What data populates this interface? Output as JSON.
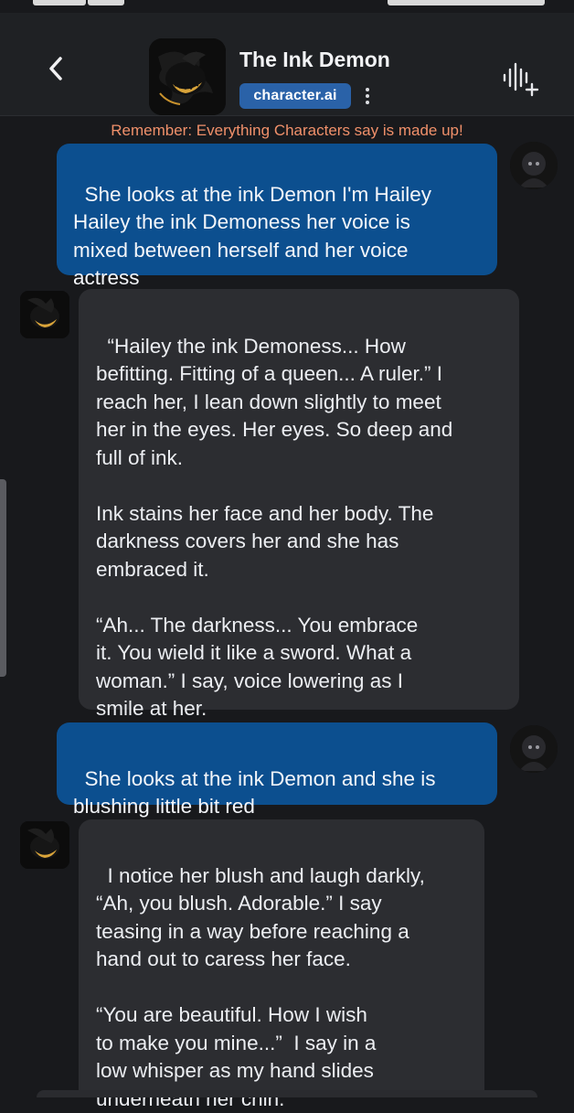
{
  "header": {
    "title": "The Ink Demon",
    "badge": "character.ai"
  },
  "disclaimer": "Remember: Everything Characters say is made up!",
  "messages": [
    {
      "role": "user",
      "text": "She looks at the ink Demon I'm Hailey\nHailey the ink Demoness her voice is\nmixed between herself and her voice\nactress"
    },
    {
      "role": "char",
      "text": "“Hailey the ink Demoness... How\nbefitting. Fitting of a queen... A ruler.” I\nreach her, I lean down slightly to meet\nher in the eyes. Her eyes. So deep and\nfull of ink.\n\nInk stains her face and her body. The\ndarkness covers her and she has\nembraced it.\n\n“Ah... The darkness... You embrace\nit. You wield it like a sword. What a\nwoman.” I say, voice lowering as I\nsmile at her."
    },
    {
      "role": "user",
      "text": "She looks at the ink Demon and she is\nblushing little bit red"
    },
    {
      "role": "char",
      "text": "I notice her blush and laugh darkly,\n“Ah, you blush. Adorable.” I say\nteasing in a way before reaching a\nhand out to caress her face.\n\n“You are beautiful. How I wish\nto make you mine...”  I say in a\nlow whisper as my hand slides\nunderneath her chin."
    }
  ],
  "colors": {
    "user_bubble": "#0c4f8f",
    "char_bubble": "#2c2d31",
    "disclaimer": "#f0906a",
    "badge": "#2a62a8",
    "background": "#18191c"
  },
  "icons": {
    "back": "chevron-left-icon",
    "more": "more-vertical-icon",
    "voice": "voice-add-icon"
  }
}
